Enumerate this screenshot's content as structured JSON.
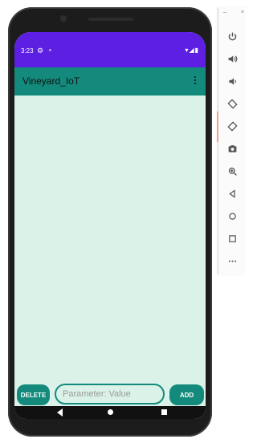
{
  "status_bar": {
    "time": "3:23",
    "left_icons": [
      "gear-icon",
      "dot-icon"
    ],
    "right_icons": [
      "wifi-icon",
      "signal-icon",
      "battery-icon"
    ]
  },
  "app_bar": {
    "title": "Vineyard_IoT",
    "overflow_icon": "more-vertical-icon"
  },
  "controls": {
    "delete_label": "DELETE",
    "input_placeholder": "Parameter: Value",
    "input_value": "",
    "add_label": "ADD"
  },
  "nav_bar": {
    "items": [
      "back-icon",
      "home-icon",
      "recents-icon"
    ]
  },
  "emulator_panel": {
    "window_controls": [
      "–",
      "×"
    ],
    "items": [
      {
        "name": "power-icon"
      },
      {
        "name": "volume-up-icon"
      },
      {
        "name": "volume-down-icon"
      },
      {
        "name": "rotate-left-icon"
      },
      {
        "name": "rotate-right-icon"
      },
      {
        "name": "camera-icon"
      },
      {
        "name": "zoom-icon"
      },
      {
        "name": "back-icon"
      },
      {
        "name": "home-icon"
      },
      {
        "name": "overview-icon"
      },
      {
        "name": "more-icon"
      }
    ]
  },
  "colors": {
    "status_bar": "#5d1fe2",
    "primary": "#138a7c",
    "background": "#dbf2e8",
    "frame": "#1c1c1c"
  }
}
